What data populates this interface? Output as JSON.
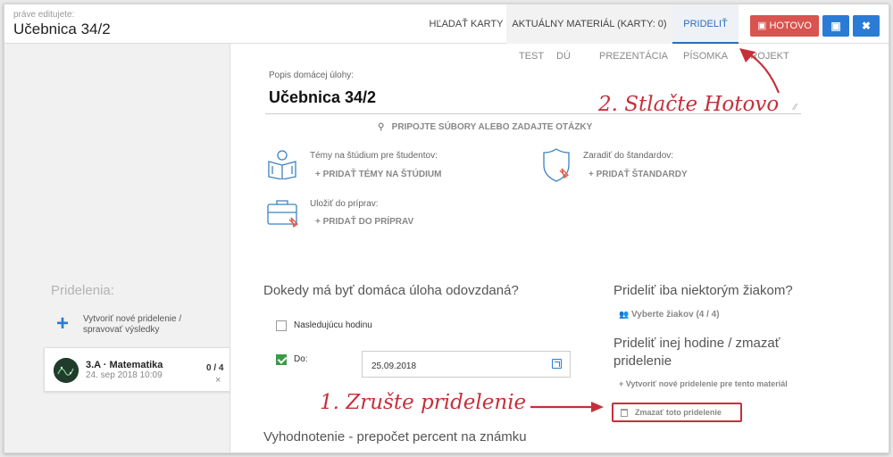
{
  "header": {
    "editing_caption": "práve editujete:",
    "editing_title": "Učebnica 34/2",
    "tabs": [
      {
        "label": "HĽADAŤ KARTY"
      },
      {
        "label": "AKTUÁLNY MATERIÁL (KARTY: 0)"
      },
      {
        "label": "PRIDELIŤ"
      }
    ],
    "done_label": "HOTOVO",
    "save_icon": "floppy-icon",
    "close_icon": "close-icon",
    "save_glyph": "▣",
    "close_glyph": "✖",
    "done_glyph": "▣"
  },
  "type_tabs": [
    "TEST",
    "DÚ",
    "PREZENTÁCIA",
    "PÍSOMKA",
    "PROJEKT"
  ],
  "description": {
    "label": "Popis domácej úlohy:",
    "value": "Učebnica 34/2",
    "attach_label": "PRIPOJTE SÚBORY ALEBO ZADAJTE OTÁZKY",
    "attach_glyph": "⚲"
  },
  "features": {
    "topics_label": "Témy na štúdium pre študentov:",
    "topics_action": "+   PRIDAŤ TÉMY NA ŠTÚDIUM",
    "standards_label": "Zaradiť do štandardov:",
    "standards_action": "+   PRIDAŤ ŠTANDARDY",
    "prep_label": "Uložiť do príprav:",
    "prep_action": "+   PRIDAŤ DO PRÍPRAV"
  },
  "sidebar": {
    "heading": "Pridelenia:",
    "plus_glyph": "+",
    "create_label": "Vytvoriť nové pridelenie / spravovať výsledky",
    "group": {
      "name": "3.A · Matematika",
      "date": "24. sep 2018 10:09",
      "count": "0 / 4",
      "remove_glyph": "×"
    }
  },
  "deadline": {
    "title": "Dokedy má byť domáca úloha odovzdaná?",
    "next_lesson_label": "Nasledujúcu hodinu",
    "until_label": "Do:",
    "date_value": "25.09.2018"
  },
  "assign": {
    "some_title": "Prideliť iba niektorým žiakom?",
    "select_students": "Vyberte žiakov (4 / 4)",
    "users_glyph": "👥",
    "other_title": "Prideliť inej hodine / zmazať pridelenie",
    "create_for_material": "+   Vytvoriť nové pridelenie pre tento materiál",
    "delete_label": "Zmazať toto pridelenie"
  },
  "evaluation_title": "Vyhodnotenie - prepočet percent na známku",
  "annotations": {
    "step2": "2. Stlačte Hotovo",
    "step1": "1. Zrušte pridelenie"
  },
  "colors": {
    "accent_blue": "#2a7bd6",
    "done_red": "#d9534f",
    "annotation_red": "#c62f3a",
    "check_green": "#3c9a46"
  }
}
